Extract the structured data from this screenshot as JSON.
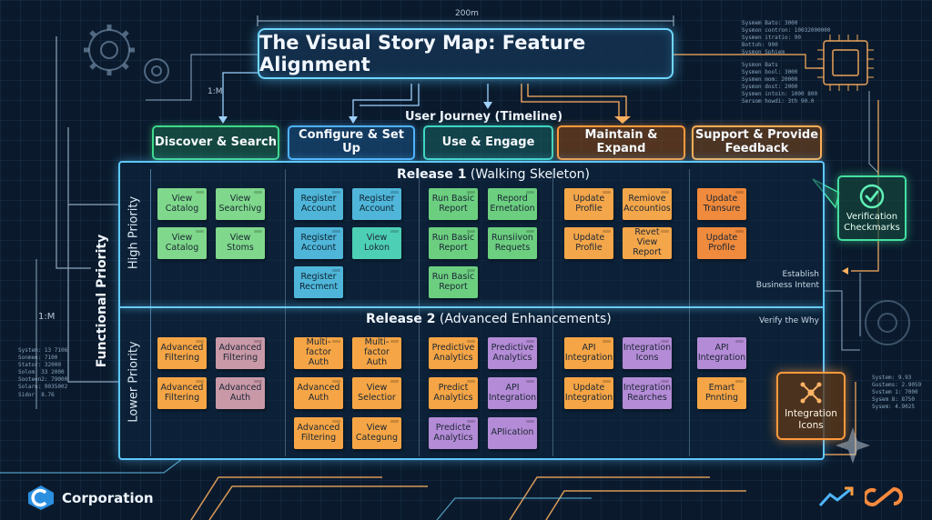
{
  "header": {
    "title": "The Visual Story Map: Feature Alignment",
    "dimension": "200m",
    "ratio_top": "1:M",
    "ratio_left": "1:M"
  },
  "journey": {
    "label": "User Journey (Timeline)",
    "activities": [
      "Discover & Search",
      "Configure & Set Up",
      "Use & Engage",
      "Maintain & Expand",
      "Support & Provide Feedback"
    ]
  },
  "axis": {
    "functional_priority": "Functional Priority",
    "high_priority": "High Priority",
    "lower_priority": "Lower Priority"
  },
  "release1": {
    "name": "Release 1",
    "subtitle": "(Walking Skeleton)",
    "cards": [
      "View Catalog",
      "View Searchivg",
      "View Catalog",
      "View Stoms",
      "Register Account",
      "Register Account",
      "Register Account",
      "View Lokon",
      "Register Recment",
      "Run Basic Report",
      "Repord Ernetation",
      "Run Basic Report",
      "Runsiivon Requets",
      "Run Basic Report",
      "Update Profile",
      "Remiove Accountios",
      "Update Profile",
      "Revet View Report",
      "Update Transure",
      "Update Profile"
    ]
  },
  "release2": {
    "name": "Release 2",
    "subtitle": "(Advanced Enhancements)",
    "cards": [
      "Advanced Filtering",
      "Advanced Filtering",
      "Advanced Filtering",
      "Advanced Auth",
      "Multi-factor Auth",
      "Multi-factor Auth",
      "Advanced Auth",
      "View Selectior",
      "Advanced Filtering",
      "View Categung",
      "Predictive Analytics",
      "Predictive Analytics",
      "Predict Analytics",
      "API Integration",
      "Predicte Analytics",
      "APIication",
      "API Integration",
      "Integration Icons",
      "Update Integration",
      "Integration Rearches",
      "API Integration",
      "Emart Pnnting"
    ]
  },
  "notes": {
    "establish": "Establish Business Intent",
    "verify": "Verify the Why"
  },
  "badges": {
    "verification": "Verification Checkmarks",
    "integration": "Integration Icons"
  },
  "sysinfo_left": [
    "System: 13 7106",
    "Sonmen: 7100",
    "Stator: 32000",
    "Solom: 33 2000",
    "Sooteen2: 79000",
    "Solarn: 9035002",
    "Sidor: 8.76"
  ],
  "sysinfo_top": [
    "Sysmem Bato: 3000",
    "Sysmon contron: 10032000000",
    "Sysmen itratio: 90",
    "Bottoh: 900",
    "Sysmon Sphiem"
  ],
  "sysinfo_top2": [
    "Sysmon Bats",
    "Sysmen bool: 3000",
    "Sysmen mom: 20000",
    "Sysmon dost: 2000",
    "Sysmen intoin: 1000 800",
    "Sersom howdi: 3th 90.0"
  ],
  "sysinfo_right": [
    "System: 9.93",
    "Gustems: 2.9059",
    "Svstem 1: 7000",
    "Sysem 8: 8750",
    "Sysem: 4.9025"
  ],
  "company": {
    "name": "Corporation"
  },
  "colors": {
    "accent": "#5ec8ff",
    "green": "#45e0a0",
    "orange": "#ff9a3c"
  }
}
